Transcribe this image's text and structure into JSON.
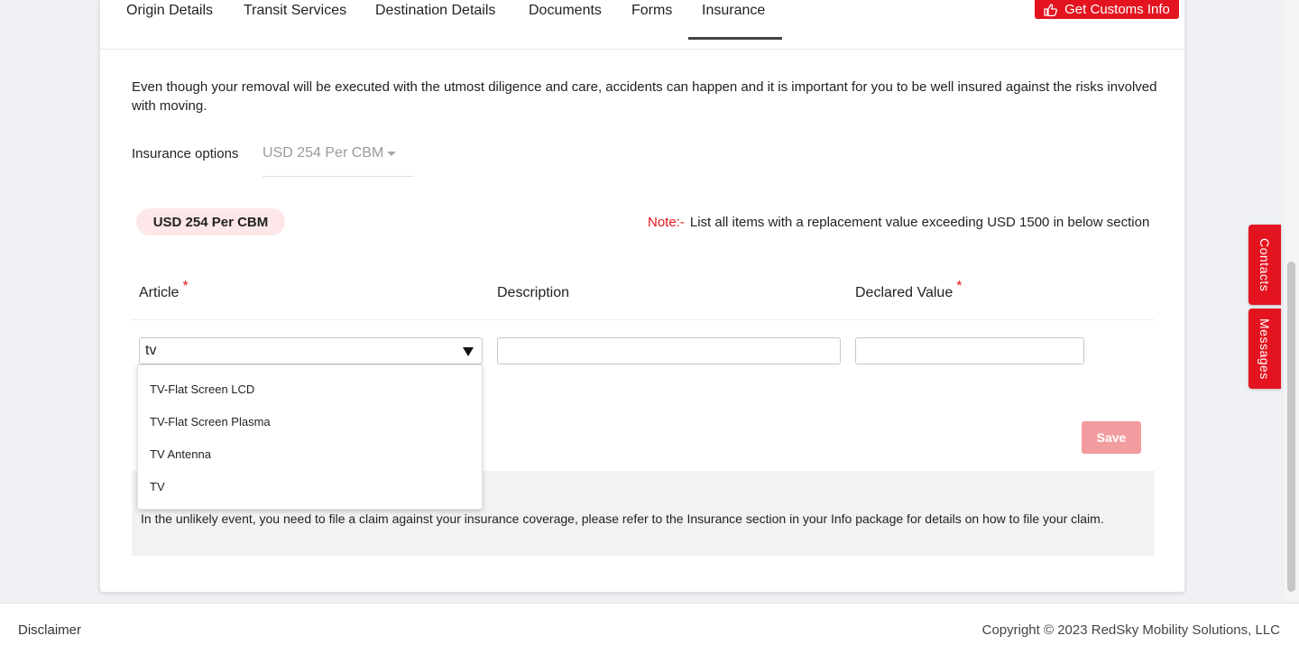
{
  "tabs": [
    {
      "label": "Origin Details"
    },
    {
      "label": "Transit Services"
    },
    {
      "label": "Destination Details"
    },
    {
      "label": "Documents"
    },
    {
      "label": "Forms"
    },
    {
      "label": "Insurance",
      "active": true
    }
  ],
  "customs_button": {
    "label": "Get Customs Info",
    "icon": "thumbs-up-icon"
  },
  "intro_text": "Even though your removal will be executed with the utmost diligence and care, accidents can happen and it is important for you to be well insured against the risks involved with moving.",
  "insurance": {
    "label": "Insurance options",
    "selected": "USD 254 Per CBM",
    "chip": "USD 254 Per CBM"
  },
  "note": {
    "label": "Note:-",
    "text": "List all items with a replacement value exceeding USD 1500 in below section"
  },
  "columns": {
    "article": "Article",
    "description": "Description",
    "declared_value": "Declared Value",
    "required_mark": "*"
  },
  "row": {
    "article_value": "tv",
    "description_value": "",
    "declared_value": ""
  },
  "dropdown_options": [
    "TV-Flat Screen LCD",
    "TV-Flat Screen Plasma",
    "TV Antenna",
    "TV"
  ],
  "save_button": {
    "label": "Save"
  },
  "claim_text": "In the unlikely event, you need to file a claim against your insurance coverage, please refer to the Insurance section in your Info package for details on how to file your claim.",
  "side_tabs": {
    "contacts": "Contacts",
    "messages": "Messages"
  },
  "footer": {
    "disclaimer": "Disclaimer",
    "copyright": "Copyright © 2023 RedSky Mobility Solutions, LLC"
  },
  "colors": {
    "accent": "#e3141f",
    "save_disabled": "#f29c9f",
    "chip_bg": "#fde7e8"
  }
}
